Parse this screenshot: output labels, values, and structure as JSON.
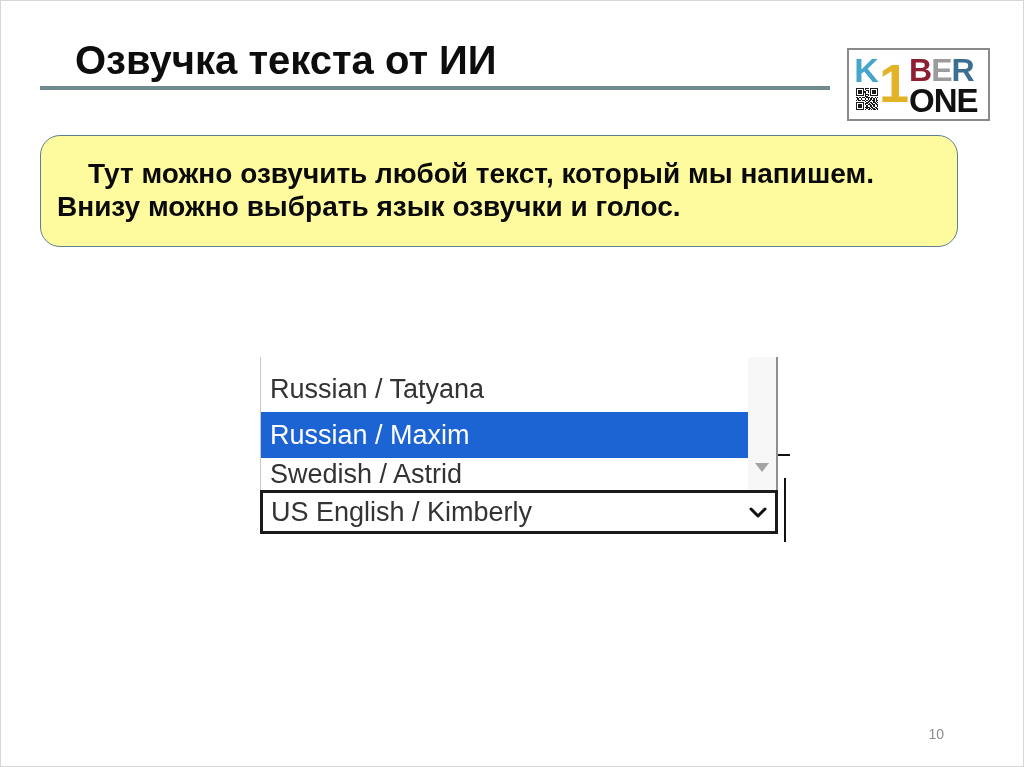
{
  "slide": {
    "title": "Озвучка текста от ИИ",
    "page_number": "10"
  },
  "logo": {
    "top_left": "K",
    "numeral": "1",
    "top_right": "BER",
    "bottom": "ONE"
  },
  "note": {
    "text": "Тут можно озвучить любой текст, который мы напишем. Внизу можно выбрать язык озвучки и голос."
  },
  "voice_picker": {
    "options": [
      {
        "label": "Russian / Tatyana",
        "selected": false
      },
      {
        "label": "Russian / Maxim",
        "selected": true
      },
      {
        "label": "Swedish / Astrid",
        "selected": false
      }
    ],
    "value": "US English / Kimberly"
  }
}
